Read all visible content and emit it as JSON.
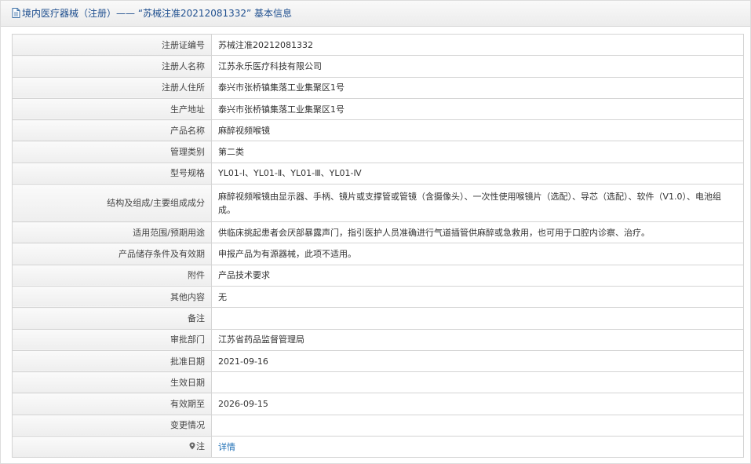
{
  "header": {
    "title": "境内医疗器械（注册）——  “苏械注准20212081332” 基本信息",
    "icon": "document-icon"
  },
  "colors": {
    "header_text": "#1f4f8f",
    "link": "#1f6fb5",
    "border": "#d4d4d4"
  },
  "rows": [
    {
      "label": "注册证编号",
      "value": "苏械注准20212081332"
    },
    {
      "label": "注册人名称",
      "value": "江苏永乐医疗科技有限公司"
    },
    {
      "label": "注册人住所",
      "value": "泰兴市张桥镇集落工业集聚区1号"
    },
    {
      "label": "生产地址",
      "value": "泰兴市张桥镇集落工业集聚区1号"
    },
    {
      "label": "产品名称",
      "value": "麻醉视频喉镜"
    },
    {
      "label": "管理类别",
      "value": "第二类"
    },
    {
      "label": "型号规格",
      "value": "YL01-Ⅰ、YL01-Ⅱ、YL01-Ⅲ、YL01-Ⅳ"
    },
    {
      "label": "结构及组成/主要组成成分",
      "value": "麻醉视频喉镜由显示器、手柄、镜片或支撑管或管镜（含摄像头）、一次性使用喉镜片（选配）、导芯（选配）、软件（V1.0）、电池组成。"
    },
    {
      "label": "适用范围/预期用途",
      "value": "供临床挑起患者会厌部暴露声门，指引医护人员准确进行气道插管供麻醉或急救用，也可用于口腔内诊察、治疗。"
    },
    {
      "label": "产品储存条件及有效期",
      "value": "申报产品为有源器械，此项不适用。"
    },
    {
      "label": "附件",
      "value": "产品技术要求"
    },
    {
      "label": "其他内容",
      "value": "无"
    },
    {
      "label": "备注",
      "value": ""
    },
    {
      "label": "审批部门",
      "value": "江苏省药品监督管理局"
    },
    {
      "label": "批准日期",
      "value": "2021-09-16"
    },
    {
      "label": "生效日期",
      "value": ""
    },
    {
      "label": "有效期至",
      "value": "2026-09-15"
    },
    {
      "label": "变更情况",
      "value": ""
    }
  ],
  "note": {
    "label": "注",
    "icon": "pin-icon",
    "link_text": "详情"
  }
}
